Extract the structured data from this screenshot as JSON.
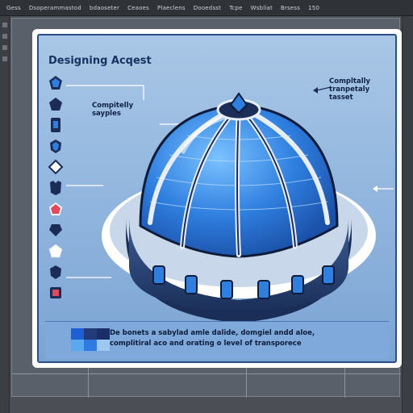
{
  "menubar": {
    "items": [
      "Gess",
      "Dsoperammastod",
      "bdaoseter",
      "Ceaoes",
      "Plaeclens",
      "Dooedsst",
      "Tcpe",
      "Wsbliat",
      "Brsess",
      "150"
    ]
  },
  "card": {
    "title": "Designing Acqest",
    "callouts": {
      "top_left": "Compitelly\nsayples",
      "top_right": "Compltally\ntranpetaly\ntasset"
    }
  },
  "info": {
    "line1": "De bonets a sabylad amle dalide, domgiel andd aloe,",
    "line2": "complitiral aco and orating o level of transporece"
  },
  "colors": {
    "frame": "#ffffff",
    "panel": "#8fb4dd",
    "dome_blue": "#2f7fe0",
    "dome_dark": "#1a2e58",
    "accent_red": "#e04a5a",
    "swatch_colors": [
      "#1f5fd6",
      "#243b7a",
      "#1a2e6a",
      "#5aa8ee",
      "#2f79e2",
      "#9cc8f2"
    ]
  },
  "icons": [
    "blue-gem-icon",
    "dark-pentagon-icon",
    "blue-panel-icon",
    "dark-shield-icon",
    "diamond-outline-icon",
    "crest-icon",
    "red-gem-icon",
    "dark-gem-icon",
    "white-gem-icon",
    "dark-shield-icon",
    "red-square-gem-icon"
  ]
}
